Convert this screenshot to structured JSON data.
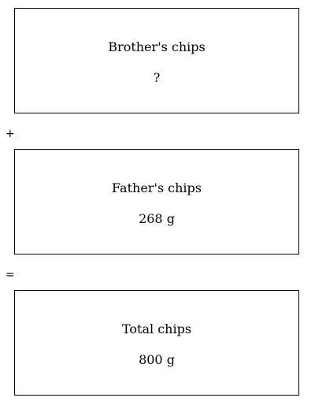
{
  "boxes": [
    {
      "label": "Brother's chips",
      "value": "?"
    },
    {
      "label": "Father's chips",
      "value": "268 g"
    },
    {
      "label": "Total chips",
      "value": "800 g"
    }
  ],
  "operators": {
    "plus": "+",
    "equals": "="
  }
}
